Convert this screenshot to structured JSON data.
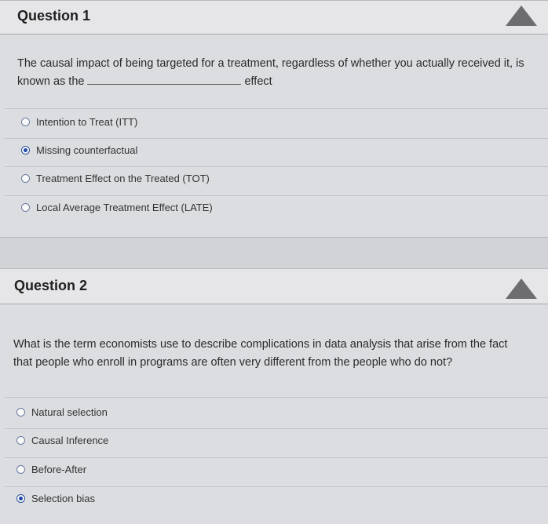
{
  "question1": {
    "title": "Question 1",
    "text_line1": "The causal impact of being targeted for a treatment, regardless of whether you actually received it, is",
    "text_prefix": "known as the",
    "text_suffix": "effect",
    "options": [
      {
        "label": "Intention to Treat (ITT)",
        "selected": false
      },
      {
        "label": "Missing counterfactual",
        "selected": true
      },
      {
        "label": "Treatment Effect on the Treated (TOT)",
        "selected": false
      },
      {
        "label": "Local Average Treatment Effect (LATE)",
        "selected": false
      }
    ]
  },
  "question2": {
    "title": "Question 2",
    "text_line1": "What is the term economists use to describe complications in data analysis that arise from the fact",
    "text_line2": "that people who enroll in programs are often very different from the people who do not?",
    "options": [
      {
        "label": "Natural selection",
        "selected": false
      },
      {
        "label": "Causal Inference",
        "selected": false
      },
      {
        "label": "Before-After",
        "selected": false
      },
      {
        "label": "Selection bias",
        "selected": true
      }
    ]
  }
}
